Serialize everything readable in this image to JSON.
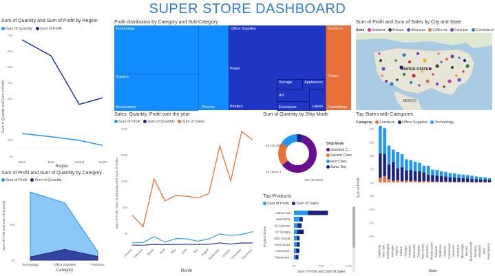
{
  "dashboard_title": "SUPER STORE DASHBOARD",
  "colors": {
    "light_blue": "#2196f3",
    "dark_blue": "#1a237e",
    "royal_blue": "#1565c0",
    "orange": "#e8703a",
    "purple": "#6a0d91",
    "title_blue": "#2b7bd6"
  },
  "region_chart": {
    "title": "Sum of Quantity and Sum of Profit by Region",
    "legend": [
      "Sum of Quantity",
      "Sum of Profit"
    ],
    "ylabel": "Sum of Quantity and Sum of Profit",
    "xlabel": "Region",
    "yticks_top": [
      "70K",
      "60K",
      "50K",
      "40K",
      "30K"
    ],
    "yticks_bottom": [
      "10K",
      "0K"
    ]
  },
  "category_chart": {
    "title": "Sum of Profit and Sum of Quantity by Category",
    "legend": [
      "Sum of Profit",
      "Sum of Quantity"
    ],
    "ylabel": "Sum of Profit and Sum of Quantity",
    "xlabel": "Category",
    "yticks": [
      "50K",
      "0K"
    ]
  },
  "treemap": {
    "title": "Profit distribution by Category and Sub-Category",
    "labels": {
      "technology": "Technology",
      "copiers": "Copiers",
      "accessories": "Accessories",
      "phones": "Phones",
      "office_supplies": "Office Supplies",
      "paper": "Paper",
      "binders": "Binders",
      "storage": "Storage",
      "appliances": "Appliances",
      "art": "Art",
      "envelopes": "Envelopes",
      "labels": "Labels",
      "furniture": "Furniture",
      "chairs": "Chairs",
      "furnishings": "Furnishings"
    }
  },
  "map_panel": {
    "title": "Sum of Profit and Sum of Sales by City and State",
    "legend_label": "State",
    "legend_items": [
      "Alabama",
      "Arizona",
      "Arkansas",
      "California",
      "Colorado",
      "Connecticut"
    ],
    "legend_colors": [
      "#d62a9b",
      "#444444",
      "#6a4bd6",
      "#e8703a",
      "#7b3bb0",
      "#2b7bd6"
    ],
    "country_label": "UNITED STATES",
    "mexico_label": "MÉXICO"
  },
  "line_chart": {
    "title": "Sales, Quantity, Profit over the year",
    "legend": [
      "Sum of Profit",
      "Sum of Quantity",
      "Sum of Sales"
    ],
    "ylabel": "Sum of Profit, Sum of Quantity and Sum of Sales",
    "xlabel": "Month",
    "yticks": [
      "200K",
      "150K",
      "100K",
      "50K",
      "0K"
    ]
  },
  "donut": {
    "title": "Sum of Quantity by Ship Mode",
    "legend_title": "Ship Mode",
    "legend_items": [
      "Standard C...",
      "Second Class",
      "First Class",
      "Same Day"
    ],
    "legend_colors": [
      "#6a0d91",
      "#e8703a",
      "#2196f3",
      "#1a237e"
    ],
    "labels": [
      "4K (10.83%)",
      "4K (19.6...)",
      "13K (59.92%)"
    ]
  },
  "top_products": {
    "title": "Top Products",
    "legend": [
      "Sum of Profit",
      "Sum of Sales"
    ],
    "ylabel": "Product Name",
    "xlabel": "Sum of Profit and Sum of Sales",
    "xticks": [
      "0K",
      "50K",
      "100K"
    ],
    "products": [
      "Canon ima...",
      "Hewlett Pa...",
      "3D Systems...",
      "HP Designj...",
      "GBC DocuB...",
      "Ativa V4110...",
      "Honeywell ...",
      "Plantronics ..."
    ]
  },
  "states_chart": {
    "title": "Top States with Categories",
    "legend_label": "Category",
    "legend": [
      "Furniture",
      "Office Supplies",
      "Technology"
    ],
    "ylabel": "Sum of Profit",
    "xlabel": "State",
    "yticks": [
      "20K",
      "15K",
      "10K",
      "5K",
      "0K",
      "-5K",
      "-10K",
      "-15K",
      "-20K"
    ]
  },
  "chart_data": [
    {
      "type": "line",
      "title": "Sum of Quantity and Sum of Profit by Region",
      "categories": [
        "West",
        "East",
        "Central",
        "South"
      ],
      "series": [
        {
          "name": "Sum of Quantity",
          "values": [
            12266,
            10618,
            8780,
            6209
          ]
        },
        {
          "name": "Sum of Profit",
          "values": [
            108418,
            91522,
            39706,
            46749
          ]
        }
      ]
    },
    {
      "type": "area",
      "title": "Sum of Profit and Sum of Quantity by Category",
      "categories": [
        "Technology",
        "Office Supplies",
        "Furniture"
      ],
      "series": [
        {
          "name": "Sum of Profit",
          "values": [
            145455,
            122491,
            18451
          ]
        },
        {
          "name": "Sum of Quantity",
          "values": [
            6939,
            22906,
            8028
          ]
        }
      ],
      "ylim": [
        0,
        150000
      ]
    },
    {
      "type": "line",
      "title": "Sales, Quantity, Profit over the year",
      "categories": [
        "January",
        "February",
        "March",
        "April",
        "May",
        "June",
        "July",
        "August",
        "September",
        "October",
        "November",
        "December"
      ],
      "series": [
        {
          "name": "Sum of Profit",
          "values": [
            9000,
            10000,
            28000,
            11000,
            22000,
            21000,
            14000,
            21000,
            36000,
            31000,
            35000,
            43000
          ]
        },
        {
          "name": "Sum of Quantity",
          "values": [
            2000,
            1600,
            4000,
            3500,
            4200,
            4300,
            4200,
            4300,
            8700,
            4900,
            8500,
            8400
          ]
        },
        {
          "name": "Sum of Sales",
          "values": [
            94000,
            59000,
            205000,
            138000,
            155000,
            152000,
            147000,
            160000,
            307000,
            200000,
            352000,
            325000
          ]
        }
      ],
      "ylim": [
        0,
        360000
      ]
    },
    {
      "type": "pie",
      "title": "Sum of Quantity by Ship Mode",
      "categories": [
        "Standard Class",
        "Second Class",
        "First Class",
        "Same Day"
      ],
      "values": [
        59.92,
        19.6,
        15.4,
        5.08
      ]
    },
    {
      "type": "bar",
      "title": "Top Products",
      "categories": [
        "Canon ima...",
        "Hewlett Pa...",
        "3D Systems...",
        "HP Designj...",
        "GBC DocuB...",
        "Ativa V4110...",
        "Honeywell ...",
        "Plantronics ..."
      ],
      "series": [
        {
          "name": "Sum of Profit",
          "values": [
            25200,
            10400,
            6800,
            6200,
            5700,
            5100,
            4000,
            3500
          ]
        },
        {
          "name": "Sum of Sales",
          "values": [
            61600,
            16000,
            13800,
            17800,
            10000,
            10400,
            9700,
            8200
          ]
        }
      ]
    },
    {
      "type": "bar",
      "title": "Top States with Categories",
      "categories": [
        "California",
        "New York",
        "Washington",
        "Michigan",
        "Virginia",
        "Indiana",
        "Georgia",
        "Kentucky",
        "Minnesota",
        "Delaware",
        "New Jersey",
        "Wisconsin",
        "Rhode Island",
        "Missouri",
        "Oklahoma",
        "Alabama",
        "Connecticut",
        "Arkansas",
        "Louisiana",
        "Mississippi",
        "Nevada",
        "Massachusetts",
        "Montana",
        "Maryland",
        "Iowa",
        "New Mexico"
      ],
      "series": [
        {
          "name": "Furniture",
          "values": [
            1800,
            2400,
            1200,
            600,
            800,
            500,
            700,
            500,
            600,
            300,
            500,
            400,
            300,
            300,
            200,
            300,
            200,
            100,
            200,
            200,
            200,
            100,
            100,
            100,
            100,
            100
          ]
        },
        {
          "name": "Office Supplies",
          "values": [
            9000,
            8200,
            5500,
            7000,
            4500,
            5200,
            3800,
            4100,
            3600,
            3800,
            3300,
            2500,
            2400,
            2200,
            2100,
            1900,
            1700,
            1700,
            1500,
            1400,
            1300,
            1200,
            1100,
            1000,
            1000,
            800
          ]
        },
        {
          "name": "Technology",
          "values": [
            11000,
            9600,
            7000,
            4600,
            6000,
            4800,
            4100,
            3700,
            3500,
            3200,
            2400,
            3300,
            2000,
            2100,
            1800,
            1700,
            1600,
            1600,
            1300,
            1300,
            1200,
            1200,
            1000,
            900,
            800,
            700
          ]
        }
      ],
      "ylim": [
        -20000,
        20000
      ]
    }
  ]
}
